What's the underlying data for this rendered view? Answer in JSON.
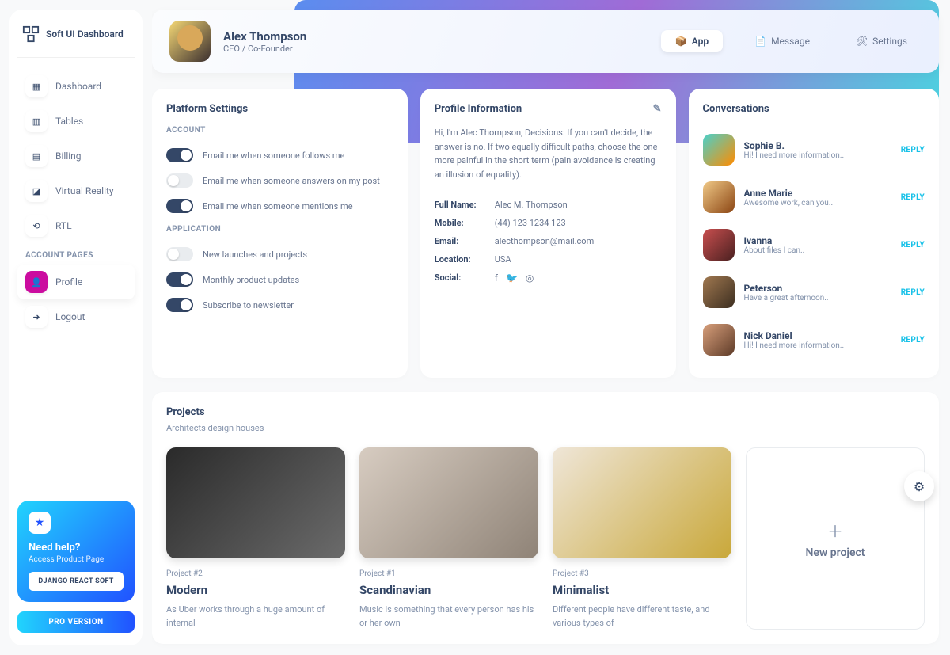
{
  "brand": "Soft UI Dashboard",
  "nav": {
    "items": [
      {
        "icon": "▦",
        "label": "Dashboard"
      },
      {
        "icon": "▥",
        "label": "Tables"
      },
      {
        "icon": "▤",
        "label": "Billing"
      },
      {
        "icon": "◪",
        "label": "Virtual Reality"
      },
      {
        "icon": "⟲",
        "label": "RTL"
      }
    ],
    "section": "Account Pages",
    "account": [
      {
        "icon": "👤",
        "label": "Profile",
        "active": true
      },
      {
        "icon": "➜",
        "label": "Logout"
      }
    ]
  },
  "help": {
    "title": "Need help?",
    "sub": "Access Product Page",
    "btn": "DJANGO REACT SOFT"
  },
  "pro": "PRO VERSION",
  "header": {
    "name": "Alex Thompson",
    "role": "CEO / Co-Founder",
    "tabs": [
      {
        "icon": "📦",
        "label": "App",
        "active": true
      },
      {
        "icon": "📄",
        "label": "Message"
      },
      {
        "icon": "🛠",
        "label": "Settings"
      }
    ]
  },
  "settings": {
    "title": "Platform Settings",
    "s1": "Account",
    "account": [
      {
        "on": true,
        "label": "Email me when someone follows me"
      },
      {
        "on": false,
        "label": "Email me when someone answers on my post"
      },
      {
        "on": true,
        "label": "Email me when someone mentions me"
      }
    ],
    "s2": "Application",
    "app": [
      {
        "on": false,
        "label": "New launches and projects"
      },
      {
        "on": true,
        "label": "Monthly product updates"
      },
      {
        "on": true,
        "label": "Subscribe to newsletter"
      }
    ]
  },
  "profile": {
    "title": "Profile Information",
    "desc": "Hi, I'm Alec Thompson, Decisions: If you can't decide, the answer is no. If two equally difficult paths, choose the one more painful in the short term (pain avoidance is creating an illusion of equality).",
    "rows": [
      {
        "k": "Full Name:",
        "v": "Alec M. Thompson"
      },
      {
        "k": "Mobile:",
        "v": "(44) 123 1234 123"
      },
      {
        "k": "Email:",
        "v": "alecthompson@mail.com"
      },
      {
        "k": "Location:",
        "v": "USA"
      }
    ],
    "social_label": "Social:"
  },
  "conversations": {
    "title": "Conversations",
    "reply": "REPLY",
    "items": [
      {
        "name": "Sophie B.",
        "msg": "Hi! I need more information..",
        "c": "c1"
      },
      {
        "name": "Anne Marie",
        "msg": "Awesome work, can you..",
        "c": "c2"
      },
      {
        "name": "Ivanna",
        "msg": "About files I can..",
        "c": "c3"
      },
      {
        "name": "Peterson",
        "msg": "Have a great afternoon..",
        "c": "c4"
      },
      {
        "name": "Nick Daniel",
        "msg": "Hi! I need more information..",
        "c": "c5"
      }
    ]
  },
  "projects": {
    "title": "Projects",
    "sub": "Architects design houses",
    "items": [
      {
        "tag": "Project #2",
        "title": "Modern",
        "desc": "As Uber works through a huge amount of internal",
        "img": "pi1"
      },
      {
        "tag": "Project #1",
        "title": "Scandinavian",
        "desc": "Music is something that every person has his or her own",
        "img": "pi2"
      },
      {
        "tag": "Project #3",
        "title": "Minimalist",
        "desc": "Different people have different taste, and various types of",
        "img": "pi3"
      }
    ],
    "new": "New project"
  }
}
